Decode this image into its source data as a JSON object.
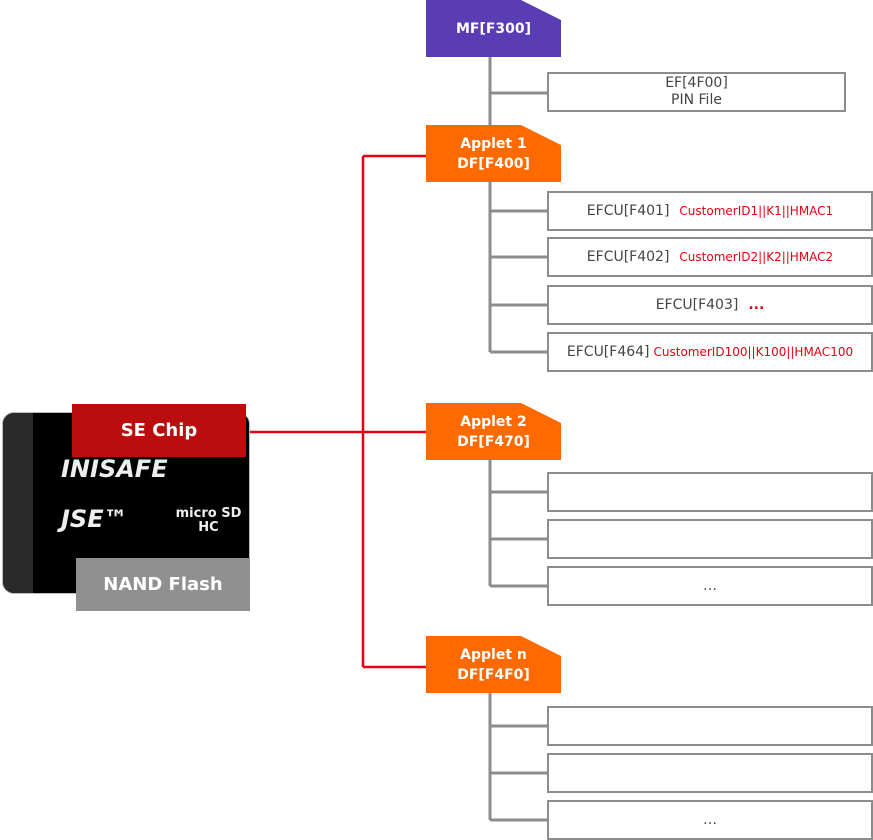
{
  "colors": {
    "mf": "#5a3db5",
    "df": "#ff6a00",
    "se_chip": "#bb0d0d",
    "nand": "#909090",
    "connector_red": "#e60012",
    "connector_gray": "#8c8c8c"
  },
  "card": {
    "brand": "INISAFE",
    "product": "JSE™",
    "logo": "micro SD HC",
    "se_chip": "SE Chip",
    "nand": "NAND Flash"
  },
  "mf": {
    "label": "MF[F300]",
    "ef": {
      "id": "EF[4F00]",
      "name": "PIN File"
    }
  },
  "applets": [
    {
      "name": "Applet 1",
      "df": "DF[F400]",
      "files": [
        {
          "id": "EFCU[F401]",
          "content": "CustomerID1||K1||HMAC1"
        },
        {
          "id": "EFCU[F402]",
          "content": "CustomerID2||K2||HMAC2"
        },
        {
          "id": "EFCU[F403]",
          "content": "..."
        },
        {
          "id": "EFCU[F464]",
          "content": "CustomerID100||K100||HMAC100"
        }
      ]
    },
    {
      "name": "Applet 2",
      "df": "DF[F470]",
      "files": [
        {
          "id": "",
          "content": ""
        },
        {
          "id": "",
          "content": ""
        },
        {
          "id": "…",
          "content": ""
        }
      ]
    },
    {
      "name": "Applet n",
      "df": "DF[F4F0]",
      "files": [
        {
          "id": "",
          "content": ""
        },
        {
          "id": "",
          "content": ""
        },
        {
          "id": "…",
          "content": ""
        }
      ]
    }
  ]
}
